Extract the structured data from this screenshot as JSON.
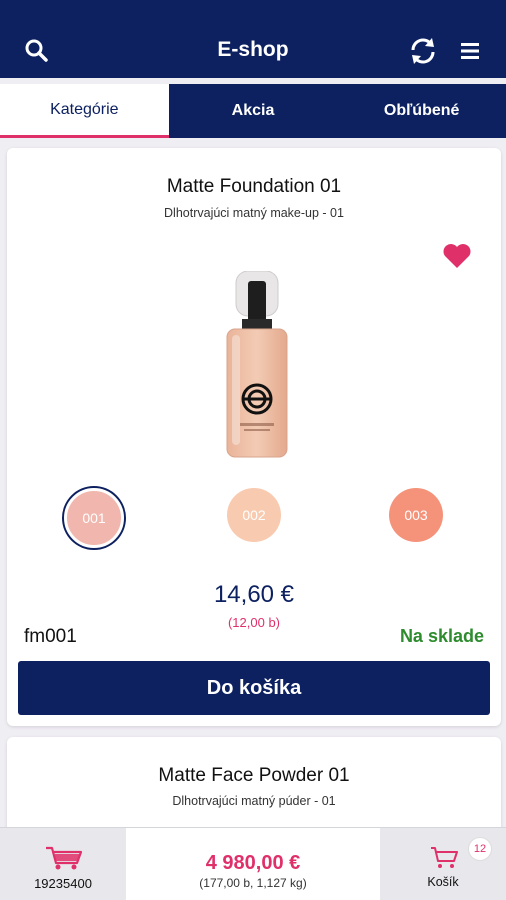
{
  "header": {
    "title": "E-shop"
  },
  "tabs": [
    {
      "label": "Kategórie",
      "active": true
    },
    {
      "label": "Akcia",
      "active": false
    },
    {
      "label": "Obľúbené",
      "active": false
    }
  ],
  "products": [
    {
      "name": "Matte Foundation 01",
      "subtitle": "Dlhotrvajúci matný make-up - 01",
      "favorite": true,
      "shades": [
        {
          "label": "001",
          "color": "#f1b6ad",
          "selected": true
        },
        {
          "label": "002",
          "color": "#f8cbb0",
          "selected": false
        },
        {
          "label": "003",
          "color": "#f5937a",
          "selected": false
        }
      ],
      "price": "14,60 €",
      "points": "(12,00 b)",
      "code": "fm001",
      "stock": "Na sklade",
      "cart_button": "Do košíka"
    },
    {
      "name": "Matte Face Powder 01",
      "subtitle": "Dlhotrvajúci matný púder - 01"
    }
  ],
  "bottombar": {
    "account_number": "19235400",
    "total": "4 980,00 €",
    "total_details": "(177,00 b, 1,127 kg)",
    "cart_label": "Košík",
    "cart_count": "12"
  },
  "colors": {
    "brand_navy": "#0d2160",
    "accent_pink": "#e0306a",
    "stock_green": "#2e8b2e"
  }
}
